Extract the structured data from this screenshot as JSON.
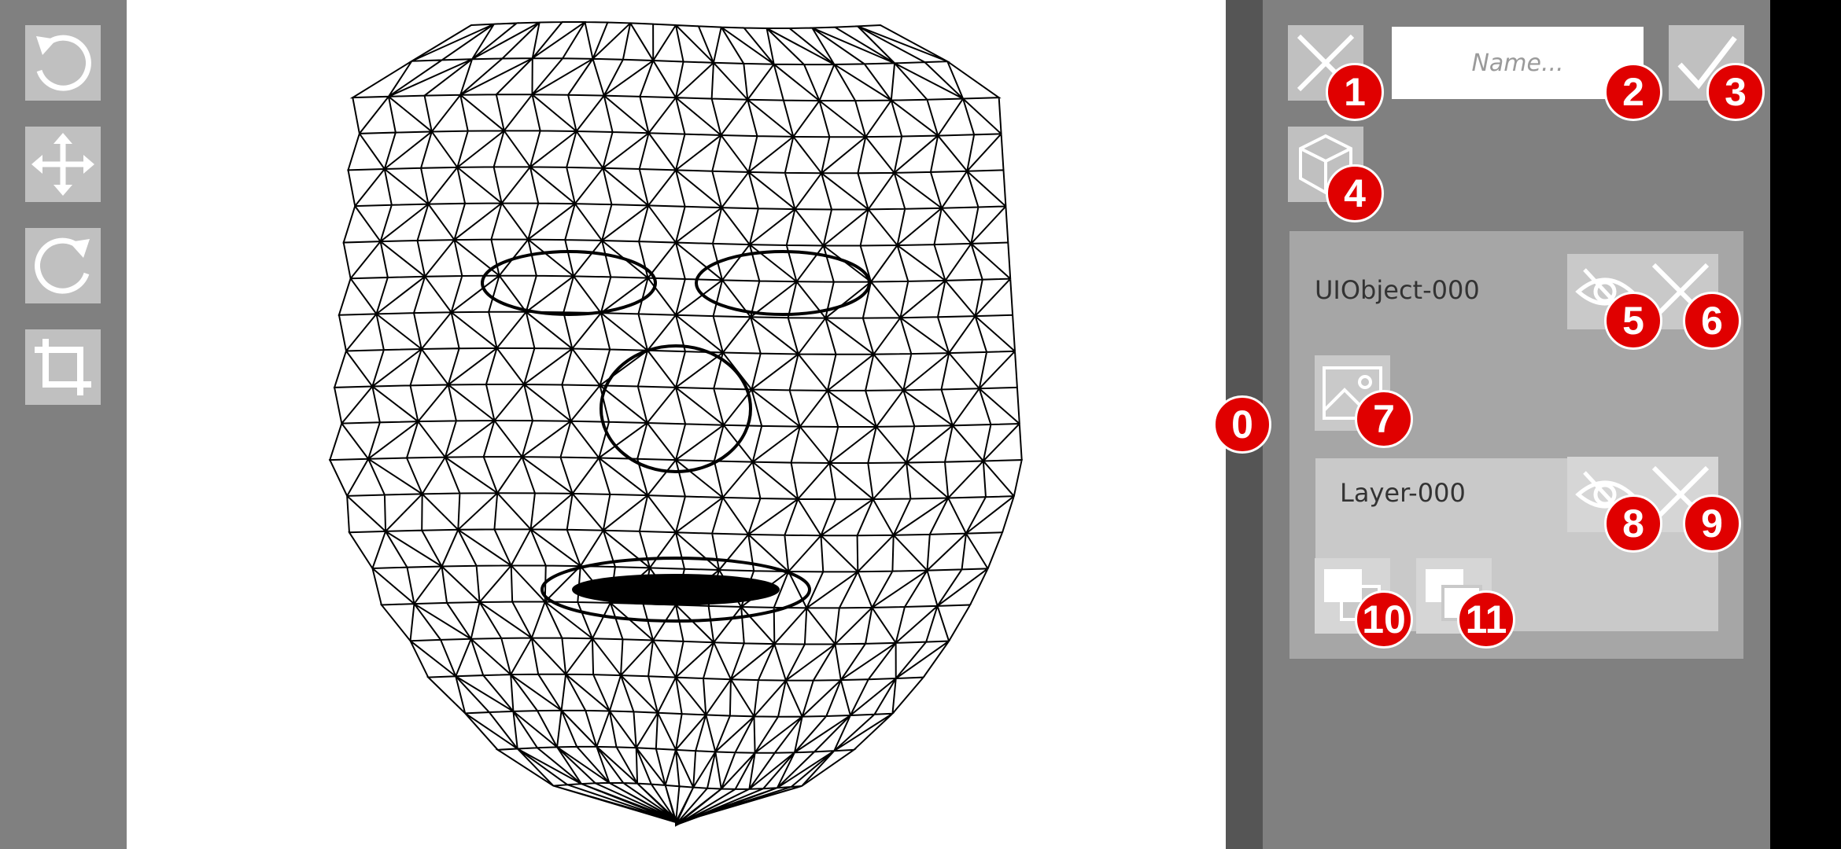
{
  "toolbar": {
    "tools": [
      {
        "icon": "rotate-ccw-icon"
      },
      {
        "icon": "move-arrows-icon"
      },
      {
        "icon": "rotate-cw-icon"
      },
      {
        "icon": "crop-icon"
      }
    ]
  },
  "canvas": {
    "content": "face-wireframe-mesh"
  },
  "panel": {
    "name_input": {
      "placeholder": "Name...",
      "value": ""
    },
    "cancel_icon": "close-icon",
    "confirm_icon": "check-icon",
    "add_object_icon": "cube-icon",
    "object": {
      "label": "UIObject-000",
      "image_icon": "image-icon",
      "layer": {
        "label": "Layer-000"
      }
    }
  },
  "badges": [
    "0",
    "1",
    "2",
    "3",
    "4",
    "5",
    "6",
    "7",
    "8",
    "9",
    "10",
    "11"
  ],
  "colors": {
    "badge": "#e00000",
    "toolbar": "#808080",
    "button": "#c0c0c0",
    "object_card": "#a6a6a6",
    "layer_card": "#c9c9c9"
  }
}
